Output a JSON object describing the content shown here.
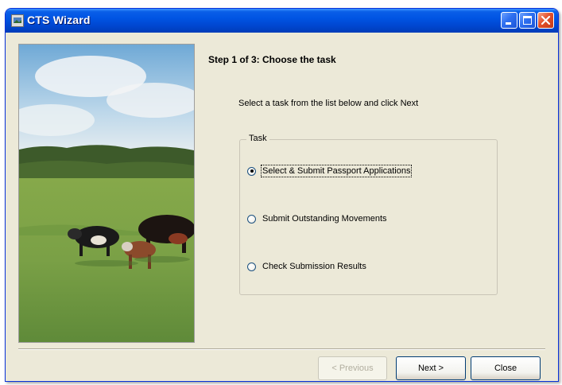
{
  "window": {
    "title": "CTS Wizard"
  },
  "title_bar_buttons": [
    "minimize-icon",
    "maximize-icon",
    "close-icon"
  ],
  "colors": {
    "titlebar": "#0054e3",
    "window_bg": "#ece9d8",
    "close_button": "#e3502b"
  },
  "photo": {
    "icon": "cows-in-field-image"
  },
  "step": {
    "title": "Step 1 of 3: Choose the task",
    "instruction": "Select a task from the list below and click Next"
  },
  "task_group": {
    "legend": "Task",
    "options": [
      {
        "label": "Select & Submit Passport Applications",
        "checked": true
      },
      {
        "label": "Submit Outstanding Movements",
        "checked": false
      },
      {
        "label": "Check Submission Results",
        "checked": false
      }
    ]
  },
  "buttons": {
    "previous": "< Previous",
    "next": "Next >",
    "close": "Close"
  }
}
